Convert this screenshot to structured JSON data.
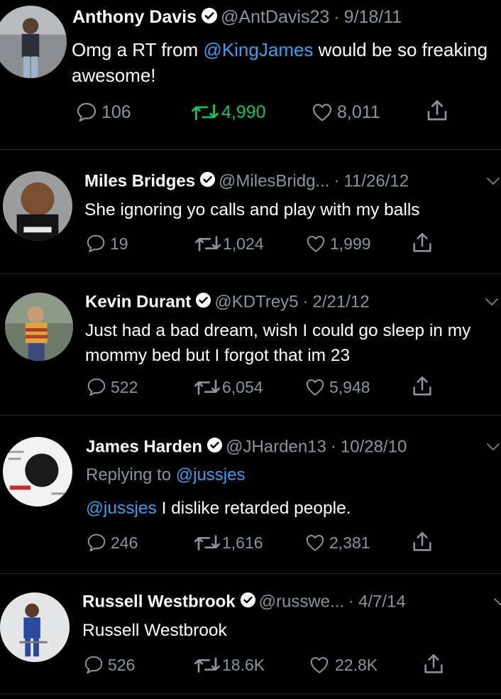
{
  "tweets": [
    {
      "name": "Anthony Davis",
      "handle": "@AntDavis23",
      "date": "9/18/11",
      "text_pre": "Omg a RT from ",
      "mention": "@KingJames",
      "text_post": " would be so freaking awesome!",
      "replies": "106",
      "retweets": "4,990",
      "likes": "8,011",
      "retweeted": true
    },
    {
      "name": "Miles Bridges",
      "handle": "@MilesBridg...",
      "date": "11/26/12",
      "text": "She ignoring yo calls and play with my balls",
      "replies": "19",
      "retweets": "1,024",
      "likes": "1,999"
    },
    {
      "name": "Kevin Durant",
      "handle": "@KDTrey5",
      "date": "2/21/12",
      "text": "Just had a bad dream, wish I could go sleep in my mommy bed but I forgot that im 23",
      "replies": "522",
      "retweets": "6,054",
      "likes": "5,948"
    },
    {
      "name": "James Harden",
      "handle": "@JHarden13",
      "date": "10/28/10",
      "replying_label": "Replying to",
      "replying_to": "@jussjes",
      "mention": "@jussjes",
      "text_post": " I dislike retarded people.",
      "replies": "246",
      "retweets": "1,616",
      "likes": "2,381"
    },
    {
      "name": "Russell Westbrook",
      "handle": "@russwe...",
      "date": "4/7/14",
      "text": "Russell Westbrook",
      "replies": "526",
      "retweets": "18.6K",
      "likes": "22.8K"
    }
  ],
  "separator": "·",
  "colors": {
    "background": "#000000",
    "link": "#3d9eea",
    "muted": "#8b939c",
    "retweet_active": "#17bf63"
  },
  "icons": [
    "verified-badge-icon",
    "reply-icon",
    "retweet-icon",
    "like-icon",
    "share-icon",
    "chevron-down-icon"
  ]
}
